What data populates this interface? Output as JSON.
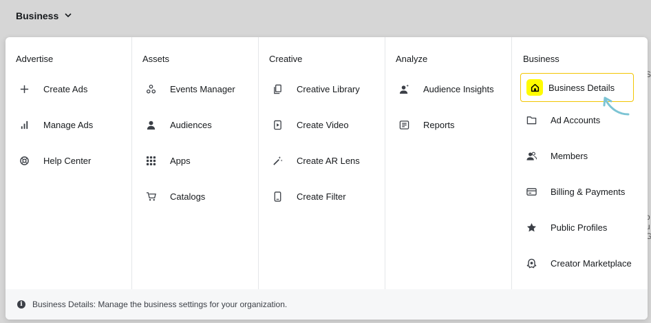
{
  "topbar": {
    "business_label": "Business"
  },
  "background_fragments": [
    "S",
    "o",
    "u",
    "G"
  ],
  "columns": [
    {
      "title": "Advertise",
      "items": [
        {
          "label": "Create Ads",
          "icon": "plus-icon"
        },
        {
          "label": "Manage Ads",
          "icon": "bar-chart-icon"
        },
        {
          "label": "Help Center",
          "icon": "lifebuoy-icon"
        }
      ]
    },
    {
      "title": "Assets",
      "items": [
        {
          "label": "Events Manager",
          "icon": "nodes-icon"
        },
        {
          "label": "Audiences",
          "icon": "person-icon"
        },
        {
          "label": "Apps",
          "icon": "grid-icon"
        },
        {
          "label": "Catalogs",
          "icon": "cart-icon"
        }
      ]
    },
    {
      "title": "Creative",
      "items": [
        {
          "label": "Creative Library",
          "icon": "copy-icon"
        },
        {
          "label": "Create Video",
          "icon": "video-icon"
        },
        {
          "label": "Create AR Lens",
          "icon": "magic-wand-icon"
        },
        {
          "label": "Create Filter",
          "icon": "phone-icon"
        }
      ]
    },
    {
      "title": "Analyze",
      "items": [
        {
          "label": "Audience Insights",
          "icon": "person-sparkle-icon"
        },
        {
          "label": "Reports",
          "icon": "report-icon"
        }
      ]
    },
    {
      "title": "Business",
      "items": [
        {
          "label": "Business Details",
          "icon": "home-icon",
          "active": true
        },
        {
          "label": "Ad Accounts",
          "icon": "folder-icon"
        },
        {
          "label": "Members",
          "icon": "members-icon"
        },
        {
          "label": "Billing & Payments",
          "icon": "card-icon"
        },
        {
          "label": "Public Profiles",
          "icon": "star-icon"
        },
        {
          "label": "Creator Marketplace",
          "icon": "ghost-icon"
        }
      ]
    }
  ],
  "footer": {
    "text": "Business Details: Manage the business settings for your organization."
  },
  "colors": {
    "accent_yellow": "#fffc00",
    "active_border": "#f2c500",
    "arrow": "#7cc4d4"
  }
}
